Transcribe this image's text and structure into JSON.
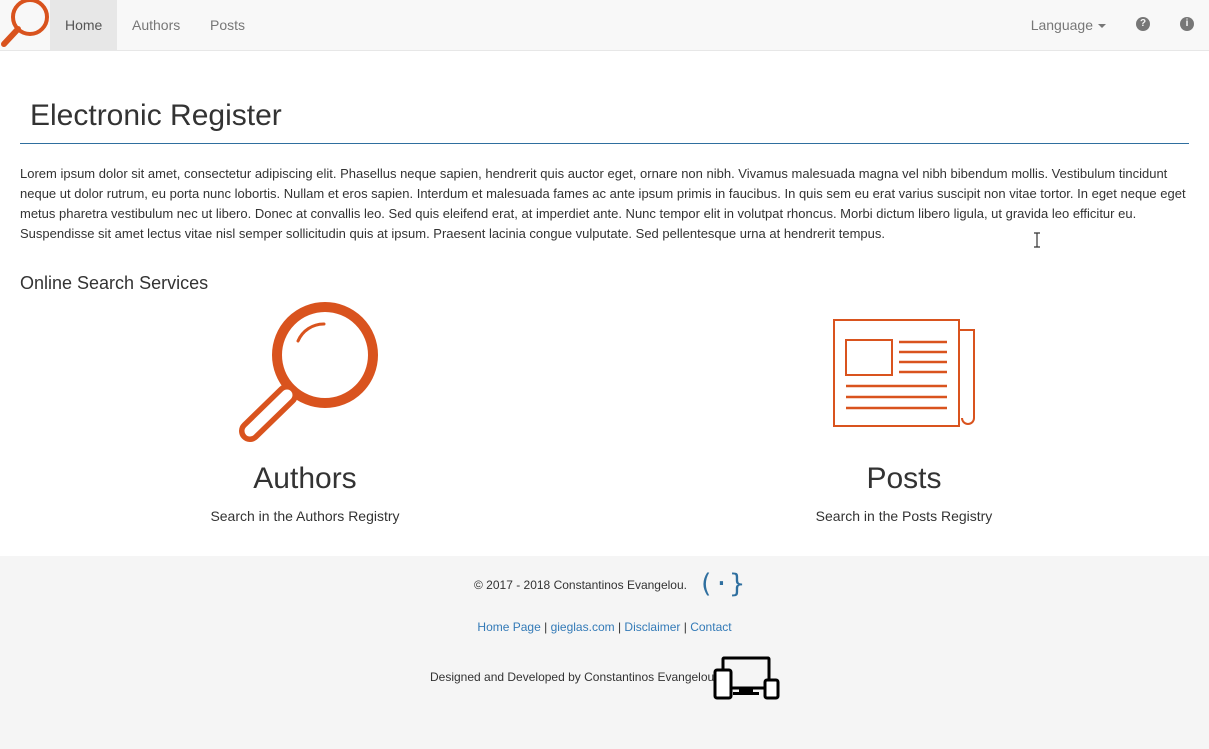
{
  "nav": {
    "items": [
      {
        "label": "Home",
        "active": true
      },
      {
        "label": "Authors",
        "active": false
      },
      {
        "label": "Posts",
        "active": false
      }
    ],
    "language_label": "Language",
    "icons": [
      "question-circle-icon",
      "info-circle-icon"
    ]
  },
  "main": {
    "title": "Electronic Register",
    "intro": "Lorem ipsum dolor sit amet, consectetur adipiscing elit. Phasellus neque sapien, hendrerit quis auctor eget, ornare non nibh. Vivamus malesuada magna vel nibh bibendum mollis. Vestibulum tincidunt neque ut dolor rutrum, eu porta nunc lobortis. Nullam et eros sapien. Interdum et malesuada fames ac ante ipsum primis in faucibus. In quis sem eu erat varius suscipit non vitae tortor. In eget neque eget metus pharetra vestibulum nec ut libero. Donec at convallis leo. Sed quis eleifend erat, at imperdiet ante. Nunc tempor elit in volutpat rhoncus. Morbi dictum libero ligula, ut gravida leo efficitur eu. Suspendisse sit amet lectus vitae nisl semper sollicitudin quis at ipsum. Praesent lacinia congue vulputate. Sed pellentesque urna at hendrerit tempus.",
    "section_title": "Online Search Services",
    "services": [
      {
        "title": "Authors",
        "description": "Search in the Authors Registry",
        "icon": "magnifier-icon"
      },
      {
        "title": "Posts",
        "description": "Search in the Posts Registry",
        "icon": "newspaper-icon"
      }
    ]
  },
  "footer": {
    "copyright": "© 2017 - 2018 Constantinos Evangelou.",
    "brace_logo": "(·}",
    "links": [
      "Home Page",
      "gieglas.com",
      "Disclaimer",
      "Contact"
    ],
    "separator": " | ",
    "designed_by": "Designed and Developed by Constantinos Evangelou"
  },
  "colors": {
    "accent": "#d9531e",
    "link": "#337ab7",
    "rule": "#2f6f9f",
    "navbar_bg": "#f8f8f8",
    "footer_bg": "#f5f5f5"
  }
}
